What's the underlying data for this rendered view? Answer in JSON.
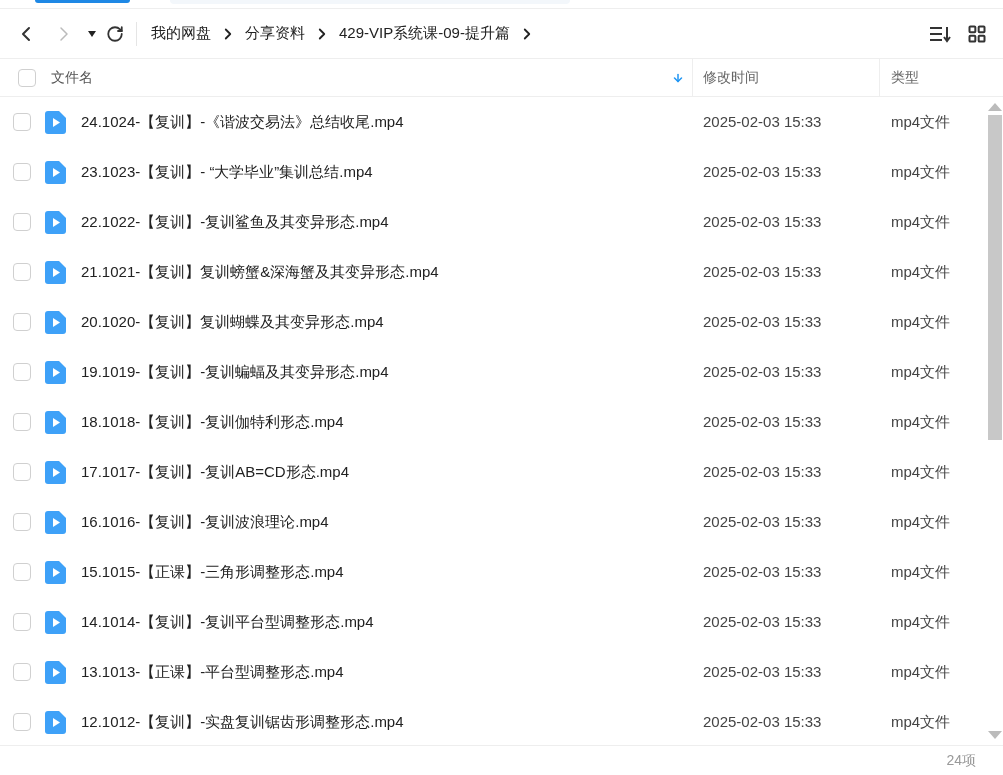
{
  "breadcrumbs": [
    "我的网盘",
    "分享资料",
    "429-VIP系统课-09-提升篇"
  ],
  "select_all": {
    "checked": false
  },
  "columns": [
    {
      "label": "文件名",
      "sorted": true
    },
    {
      "label": "修改时间",
      "sorted": false
    },
    {
      "label": "类型",
      "sorted": false
    }
  ],
  "rows": [
    {
      "name": "24.1024-【复训】-《谐波交易法》总结收尾.mp4",
      "modified": "2025-02-03 15:33",
      "type": "mp4文件",
      "checked": false
    },
    {
      "name": "23.1023-【复训】- “大学毕业”集训总结.mp4",
      "modified": "2025-02-03 15:33",
      "type": "mp4文件",
      "checked": false
    },
    {
      "name": "22.1022-【复训】-复训鲨鱼及其变异形态.mp4",
      "modified": "2025-02-03 15:33",
      "type": "mp4文件",
      "checked": false
    },
    {
      "name": "21.1021-【复训】复训螃蟹&深海蟹及其变异形态.mp4",
      "modified": "2025-02-03 15:33",
      "type": "mp4文件",
      "checked": false
    },
    {
      "name": "20.1020-【复训】复训蝴蝶及其变异形态.mp4",
      "modified": "2025-02-03 15:33",
      "type": "mp4文件",
      "checked": false
    },
    {
      "name": "19.1019-【复训】-复训蝙蝠及其变异形态.mp4",
      "modified": "2025-02-03 15:33",
      "type": "mp4文件",
      "checked": false
    },
    {
      "name": "18.1018-【复训】-复训伽特利形态.mp4",
      "modified": "2025-02-03 15:33",
      "type": "mp4文件",
      "checked": false
    },
    {
      "name": "17.1017-【复训】-复训AB=CD形态.mp4",
      "modified": "2025-02-03 15:33",
      "type": "mp4文件",
      "checked": false
    },
    {
      "name": "16.1016-【复训】-复训波浪理论.mp4",
      "modified": "2025-02-03 15:33",
      "type": "mp4文件",
      "checked": false
    },
    {
      "name": "15.1015-【正课】-三角形调整形态.mp4",
      "modified": "2025-02-03 15:33",
      "type": "mp4文件",
      "checked": false
    },
    {
      "name": "14.1014-【复训】-复训平台型调整形态.mp4",
      "modified": "2025-02-03 15:33",
      "type": "mp4文件",
      "checked": false
    },
    {
      "name": "13.1013-【正课】-平台型调整形态.mp4",
      "modified": "2025-02-03 15:33",
      "type": "mp4文件",
      "checked": false
    },
    {
      "name": "12.1012-【复训】-实盘复训锯齿形调整形态.mp4",
      "modified": "2025-02-03 15:33",
      "type": "mp4文件",
      "checked": false
    }
  ],
  "footer": {
    "count": "24项"
  }
}
